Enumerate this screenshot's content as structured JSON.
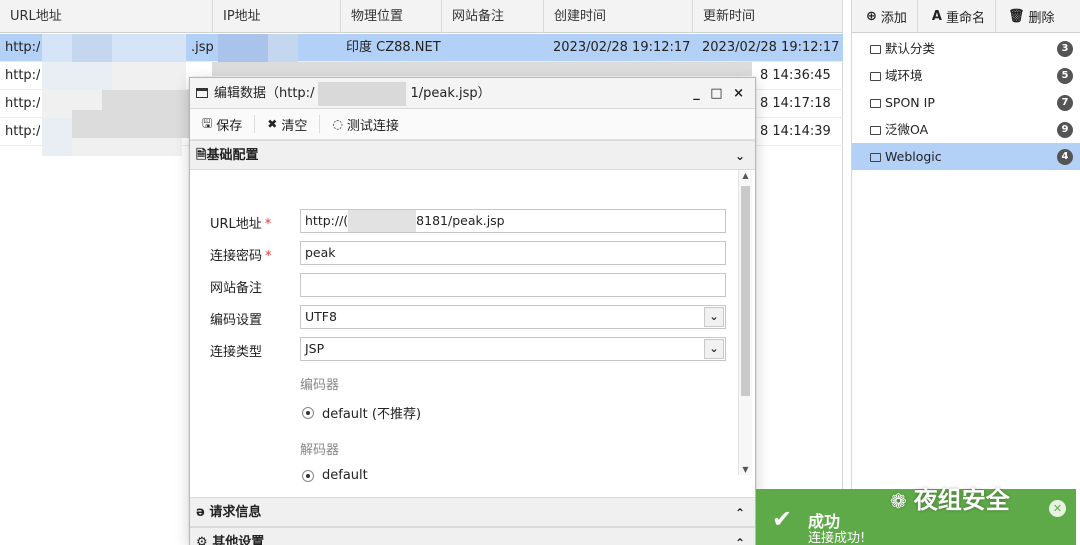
{
  "table": {
    "headers": [
      "URL地址",
      "IP地址",
      "物理位置",
      "网站备注",
      "创建时间",
      "更新时间"
    ],
    "rows": [
      {
        "url_prefix": "http:/",
        "url_suffix": ".jsp",
        "ip": "",
        "location": "印度 CZ88.NET",
        "note": "",
        "created": "2023/02/28 19:12:17",
        "updated": "2023/02/28 19:12:17"
      },
      {
        "url_prefix": "http:/",
        "url_suffix": "",
        "ip": "",
        "location": "",
        "note": "",
        "created": "",
        "updated": "8 14:36:45"
      },
      {
        "url_prefix": "http:/",
        "url_suffix": "",
        "ip": "",
        "location": "",
        "note": "",
        "created": "",
        "updated": "8 14:17:18"
      },
      {
        "url_prefix": "http:/",
        "url_suffix": "",
        "ip": "",
        "location": "",
        "note": "",
        "created": "",
        "updated": "8 14:14:39"
      }
    ]
  },
  "side": {
    "toolbar": {
      "add": "添加",
      "rename": "重命名",
      "delete": "删除"
    },
    "categories": [
      {
        "label": "默认分类",
        "count": "3"
      },
      {
        "label": "域环境",
        "count": "5"
      },
      {
        "label": "SPON IP",
        "count": "7"
      },
      {
        "label": "泛微OA",
        "count": "9"
      },
      {
        "label": "Weblogic",
        "count": "4"
      }
    ]
  },
  "dialog": {
    "title_prefix": "编辑数据（http:/",
    "title_suffix": "1/peak.jsp）",
    "controls": "_ □ ×",
    "toolbar": {
      "save": "保存",
      "clear": "清空",
      "test": "测试连接"
    },
    "section_basic": "基础配置",
    "section_request": "请求信息",
    "section_other": "其他设置",
    "form": {
      "url_label": "URL地址",
      "url_prefix": "http://(",
      "url_suffix": "8181/peak.jsp",
      "pwd_label": "连接密码",
      "pwd_value": "peak",
      "note_label": "网站备注",
      "note_value": "",
      "encoding_label": "编码设置",
      "encoding_value": "UTF8",
      "type_label": "连接类型",
      "type_value": "JSP",
      "encoder_head": "编码器",
      "encoder_option": "default (不推荐)",
      "decoder_head": "解码器",
      "decoder_option": "default"
    }
  },
  "toast": {
    "title": "成功",
    "message": "连接成功!"
  },
  "watermark": "夜组安全"
}
